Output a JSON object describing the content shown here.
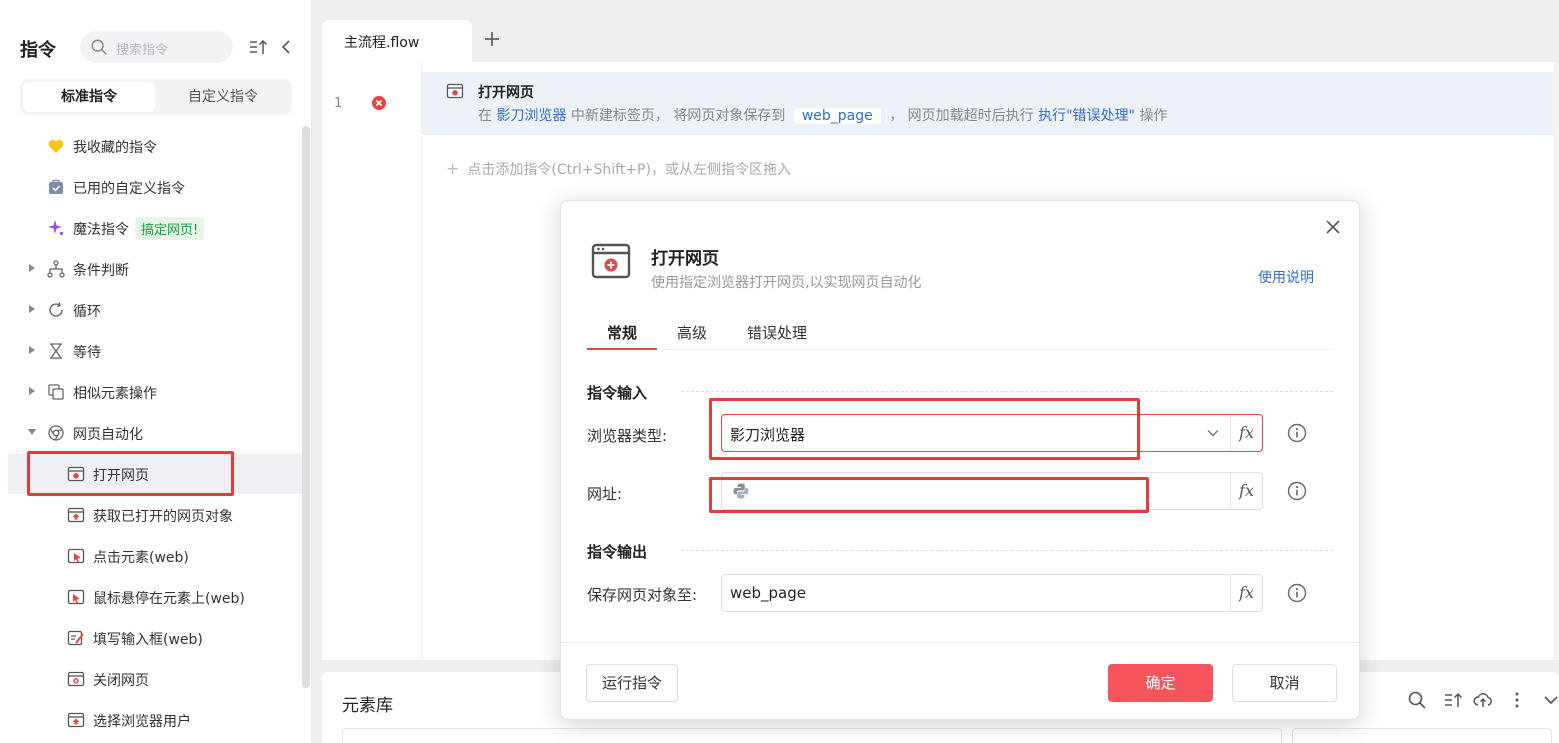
{
  "sidebar": {
    "title": "指令",
    "search_placeholder": "搜索指令",
    "tabs": [
      "标准指令",
      "自定义指令"
    ],
    "items": [
      {
        "label": "我收藏的指令",
        "icon": "heart-icon"
      },
      {
        "label": "已用的自定义指令",
        "icon": "bag-icon"
      },
      {
        "label": "魔法指令",
        "icon": "sparkle-icon",
        "badge": "搞定网页!"
      },
      {
        "label": "条件判断",
        "icon": "branch-icon"
      },
      {
        "label": "循环",
        "icon": "loop-icon"
      },
      {
        "label": "等待",
        "icon": "hourglass-icon"
      },
      {
        "label": "相似元素操作",
        "icon": "copy-icon"
      },
      {
        "label": "网页自动化",
        "icon": "chrome-icon"
      },
      {
        "label": "打开网页",
        "icon": "browser-icon"
      },
      {
        "label": "获取已打开的网页对象",
        "icon": "browser-up-icon"
      },
      {
        "label": "点击元素(web)",
        "icon": "click-icon"
      },
      {
        "label": "鼠标悬停在元素上(web)",
        "icon": "hover-icon"
      },
      {
        "label": "填写输入框(web)",
        "icon": "edit-icon"
      },
      {
        "label": "关闭网页",
        "icon": "browser-close-icon"
      },
      {
        "label": "选择浏览器用户",
        "icon": "browser-user-icon"
      }
    ]
  },
  "editor": {
    "tab_label": "主流程.flow",
    "line_number": "1",
    "command": {
      "title": "打开网页",
      "desc_prefix": "在",
      "browser": "影刀浏览器",
      "desc_mid1": "中新建标签页， 将网页对象保存到",
      "var": "web_page",
      "desc_mid2": "， 网页加载超时后执行",
      "action": "执行\"错误处理\"",
      "desc_suffix": "操作"
    },
    "add_hint": "点击添加指令(Ctrl+Shift+P)，或从左侧指令区拖入"
  },
  "bottom_panel": {
    "title": "元素库"
  },
  "modal": {
    "title": "打开网页",
    "subtitle": "使用指定浏览器打开网页,以实现网页自动化",
    "help_link": "使用说明",
    "tabs": [
      "常规",
      "高级",
      "错误处理"
    ],
    "input_section": "指令输入",
    "output_section": "指令输出",
    "browser_label": "浏览器类型:",
    "browser_value": "影刀浏览器",
    "url_label": "网址:",
    "url_value": "",
    "save_label": "保存网页对象至:",
    "save_value": "web_page",
    "fx": "fx",
    "run_button": "运行指令",
    "ok_button": "确定",
    "cancel_button": "取消"
  },
  "colors": {
    "accent": "#f4545a",
    "link": "#2f6fd8",
    "highlight_box": "#e83a3a"
  }
}
